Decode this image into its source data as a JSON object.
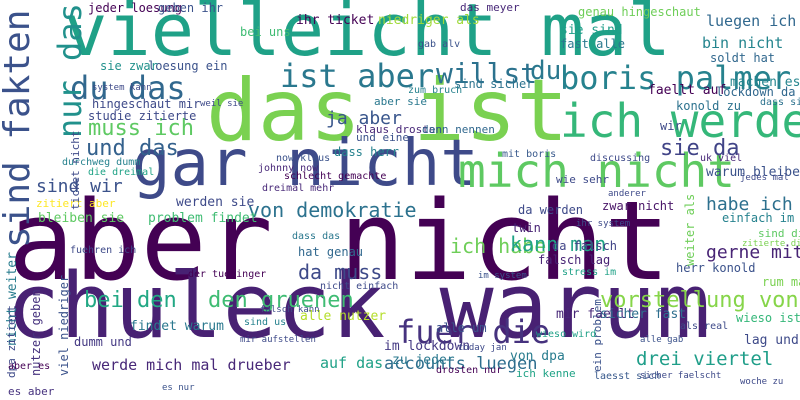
{
  "words": [
    {
      "text": "aber nicht",
      "color": "#440154"
    },
    {
      "text": "chuleck warum",
      "color": "#482173"
    },
    {
      "text": "das ist",
      "color": "#7ad151"
    },
    {
      "text": "vielleicht mal",
      "color": "#1fa187"
    },
    {
      "text": "gar nicht",
      "color": "#3e4a89"
    },
    {
      "text": "mich nicht",
      "color": "#5ec962"
    },
    {
      "text": "ich werde",
      "color": "#35b779"
    },
    {
      "text": "sind fakten",
      "color": "#3b528b"
    },
    {
      "text": "boris palmer",
      "color": "#26828e"
    },
    {
      "text": "ist aber",
      "color": "#2a788e"
    },
    {
      "text": "du das",
      "color": "#31688e"
    },
    {
      "text": "nur das",
      "color": "#21918c"
    },
    {
      "text": "fuer die",
      "color": "#46327e"
    },
    {
      "text": "von demokratie",
      "color": "#2c728e"
    },
    {
      "text": "bei den",
      "color": "#22a884"
    },
    {
      "text": "den gruenen",
      "color": "#3fbc73"
    },
    {
      "text": "vorstellung von",
      "color": "#86d549"
    },
    {
      "text": "werde mich mal drueber",
      "color": "#482878"
    },
    {
      "text": "drei viertel",
      "color": "#1f9e89"
    },
    {
      "text": "accounts luegen",
      "color": "#2e6e8e"
    },
    {
      "text": "muss ich",
      "color": "#5ec962"
    },
    {
      "text": "und das",
      "color": "#34618d"
    },
    {
      "text": "willst",
      "color": "#2c728e"
    },
    {
      "text": "ja aber",
      "color": "#39568c"
    },
    {
      "text": "sie da",
      "color": "#414487"
    },
    {
      "text": "sind wir",
      "color": "#3b528b"
    },
    {
      "text": "habe ich",
      "color": "#2d708e"
    },
    {
      "text": "ich habe",
      "color": "#6ece58"
    },
    {
      "text": "da muss",
      "color": "#3e4a89"
    },
    {
      "text": "kann man",
      "color": "#20a386"
    },
    {
      "text": "gerne mit",
      "color": "#482475"
    },
    {
      "text": "bin nicht",
      "color": "#25858e"
    },
    {
      "text": "luegen ich",
      "color": "#31688e"
    },
    {
      "text": "du",
      "color": "#2a788e"
    },
    {
      "text": "alle nutzer",
      "color": "#b5de2b"
    },
    {
      "text": "findet warum",
      "color": "#2a788e"
    },
    {
      "text": "im lockdown",
      "color": "#443983"
    },
    {
      "text": "lag und",
      "color": "#3e4a89"
    },
    {
      "text": "alle um",
      "color": "#3b528b"
    },
    {
      "text": "auf das",
      "color": "#1fa187"
    },
    {
      "text": "mir faellt",
      "color": "#482878"
    },
    {
      "text": "von dpa",
      "color": "#287c8e"
    },
    {
      "text": "zu jeder",
      "color": "#2a788e"
    },
    {
      "text": "drosten nur",
      "color": "#440154"
    },
    {
      "text": "ich kenne",
      "color": "#20a386"
    },
    {
      "text": "dass herr",
      "color": "#26828e"
    },
    {
      "text": "laesst sich",
      "color": "#38598c"
    },
    {
      "text": "es aber",
      "color": "#46327e"
    },
    {
      "text": "sicher fast",
      "color": "#2e6e8e"
    },
    {
      "text": "wieso ist",
      "color": "#35b779"
    },
    {
      "text": "warum bleiben",
      "color": "#3b528b"
    },
    {
      "text": "bleiben sie",
      "color": "#5ec962"
    },
    {
      "text": "problem findet",
      "color": "#3fbc73"
    },
    {
      "text": "werden sie",
      "color": "#3e4a89"
    },
    {
      "text": "zitiert aber",
      "color": "#fde725"
    },
    {
      "text": "hat genau",
      "color": "#31688e"
    },
    {
      "text": "fast alle",
      "color": "#2a788e"
    },
    {
      "text": "sie sind",
      "color": "#1f9e89"
    },
    {
      "text": "machen es",
      "color": "#25858e"
    },
    {
      "text": "soldt hat",
      "color": "#31688e"
    },
    {
      "text": "faellt auf",
      "color": "#440154"
    },
    {
      "text": "lockdown da",
      "color": "#31688e"
    },
    {
      "text": "konold zu",
      "color": "#2c728e"
    },
    {
      "text": "nicht weiter",
      "color": "#287c8e"
    },
    {
      "text": "dpa zitiert",
      "color": "#3e4a89"
    },
    {
      "text": "nutzer geben",
      "color": "#46327e"
    },
    {
      "text": "dumm und",
      "color": "#443983"
    },
    {
      "text": "viel niedriger",
      "color": "#3b528b"
    },
    {
      "text": "herr konold",
      "color": "#3b528b"
    },
    {
      "text": "rum machen",
      "color": "#7ad151"
    },
    {
      "text": "zwar nicht",
      "color": "#481467"
    },
    {
      "text": "da werden",
      "color": "#3e4a89"
    },
    {
      "text": "da falsch",
      "color": "#414487"
    },
    {
      "text": "falsch lag",
      "color": "#482475"
    },
    {
      "text": "einfach im",
      "color": "#26828e"
    },
    {
      "text": "zitierte die",
      "color": "#7ad151"
    },
    {
      "text": "sind die",
      "color": "#5ec962"
    },
    {
      "text": "weiter als",
      "color": "#6ece58"
    },
    {
      "text": "sind sicher",
      "color": "#2c728e"
    },
    {
      "text": "loesung ein",
      "color": "#3b528b"
    },
    {
      "text": "genau hingeschaut",
      "color": "#6ece58"
    },
    {
      "text": "hingeschaut mir",
      "color": "#3e4a89"
    },
    {
      "text": "studie zitierte",
      "color": "#3e4a89"
    },
    {
      "text": "klaus drosten",
      "color": "#482878"
    },
    {
      "text": "und eine",
      "color": "#3b528b"
    },
    {
      "text": "dann nennen",
      "color": "#31688e"
    },
    {
      "text": "aber sie",
      "color": "#2a788e"
    },
    {
      "text": "ihr ticket",
      "color": "#440154"
    },
    {
      "text": "niedriger als",
      "color": "#a0da39"
    },
    {
      "text": "das meyer",
      "color": "#482878"
    },
    {
      "text": "jeder loesung",
      "color": "#440154"
    },
    {
      "text": "geben ihr",
      "color": "#3b528b"
    },
    {
      "text": "sie zwar",
      "color": "#21918c"
    },
    {
      "text": "wie sehr",
      "color": "#3e4a89"
    },
    {
      "text": "bei uns",
      "color": "#3fbc73"
    },
    {
      "text": "schlecht gemachte",
      "color": "#440154"
    },
    {
      "text": "dreimal mehr",
      "color": "#482878"
    },
    {
      "text": "now klaus",
      "color": "#3b528b"
    },
    {
      "text": "johnny now",
      "color": "#482878"
    },
    {
      "text": "der tuebinger",
      "color": "#440154"
    },
    {
      "text": "die dreimal",
      "color": "#20a386"
    },
    {
      "text": "durchweg dumm",
      "color": "#26828e"
    },
    {
      "text": "twin",
      "color": "#482475"
    },
    {
      "text": "im system",
      "color": "#3b528b"
    },
    {
      "text": "stress im",
      "color": "#1fa187"
    },
    {
      "text": "wir",
      "color": "#3e4a89"
    },
    {
      "text": "uk viel",
      "color": "#482878"
    },
    {
      "text": "ticket nicht",
      "color": "#3e4a89"
    },
    {
      "text": "mit boris",
      "color": "#38598c"
    },
    {
      "text": "aber es",
      "color": "#440154"
    },
    {
      "text": "discussing",
      "color": "#3e4a89"
    },
    {
      "text": "gab alv",
      "color": "#3b528b"
    },
    {
      "text": "ein problem",
      "color": "#3b528b"
    },
    {
      "text": "zum bruch",
      "color": "#26828e"
    },
    {
      "text": "dass das",
      "color": "#2a788e"
    },
    {
      "text": "nicht einfach",
      "color": "#3e4a89"
    },
    {
      "text": "fuehren ich",
      "color": "#3e4a89"
    },
    {
      "text": "wieso wird",
      "color": "#1fa187"
    },
    {
      "text": "sind us",
      "color": "#26828e"
    },
    {
      "text": "today jan",
      "color": "#3e4a89"
    },
    {
      "text": "sicher faelscht",
      "color": "#3e4a89"
    },
    {
      "text": "mir aufstellen",
      "color": "#3e4a89"
    },
    {
      "text": "alle gab",
      "color": "#3b528b"
    },
    {
      "text": "dass sie",
      "color": "#2c728e"
    },
    {
      "text": "ihr system",
      "color": "#3e4a89"
    },
    {
      "text": "als real",
      "color": "#3e4a89"
    },
    {
      "text": "falsch kann",
      "color": "#3e4a89"
    },
    {
      "text": "woche zu",
      "color": "#3e4a89"
    },
    {
      "text": "anderer",
      "color": "#3e4a89"
    },
    {
      "text": "system kann",
      "color": "#3e4a89"
    },
    {
      "text": "es nur",
      "color": "#3b528b"
    },
    {
      "text": "jedes mal",
      "color": "#3e4a89"
    },
    {
      "text": "weil sie",
      "color": "#3e4a89"
    }
  ]
}
